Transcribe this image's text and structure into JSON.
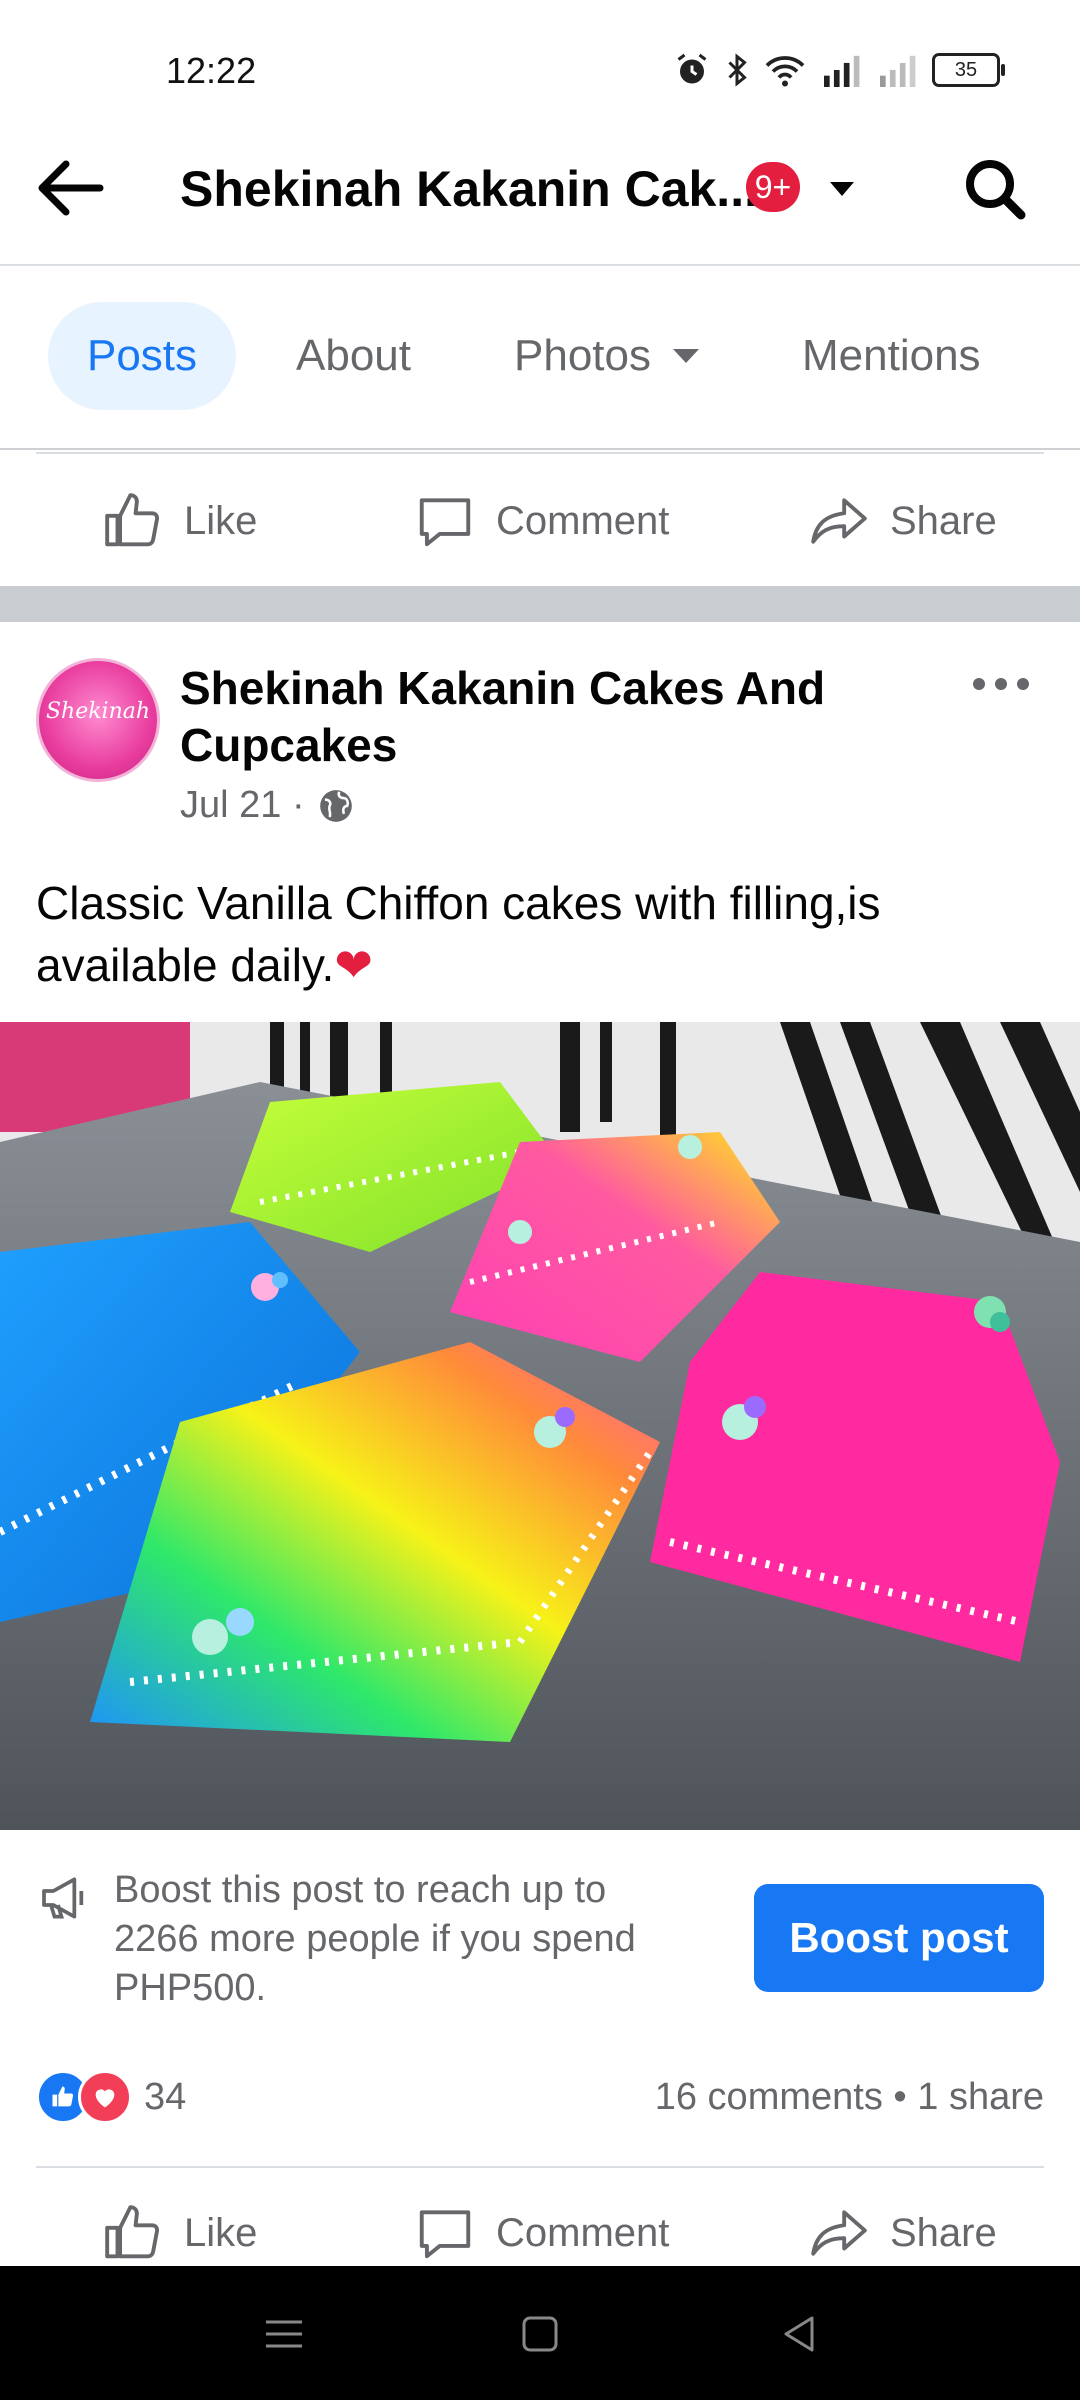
{
  "status": {
    "time": "12:22",
    "battery": "35",
    "icons": [
      "alarm-icon",
      "bluetooth-icon",
      "wifi-icon",
      "signal-icon",
      "signal-icon-2",
      "battery-icon"
    ]
  },
  "header": {
    "title": "Shekinah Kakanin Cak...",
    "badge": "9+"
  },
  "tabs": [
    {
      "label": "Posts",
      "active": true
    },
    {
      "label": "About"
    },
    {
      "label": "Photos"
    },
    {
      "label": "Mentions"
    }
  ],
  "actions": {
    "like": "Like",
    "comment": "Comment",
    "share": "Share"
  },
  "post": {
    "author": "Shekinah Kakanin Cakes And Cupcakes",
    "avatar_text": "Shekinah",
    "date": "Jul 21 ·",
    "text": "Classic Vanilla Chiffon cakes with filling,is available daily.",
    "emoji": "❤"
  },
  "boost": {
    "text": "Boost this post to reach up to 2266 more people if you spend PHP500.",
    "button": "Boost post"
  },
  "engagement": {
    "reaction_count": "34",
    "comments_shares": "16 comments • 1 share"
  },
  "colors": {
    "accent": "#1877f2",
    "badge": "#e41e3f",
    "muted": "#65676b"
  }
}
